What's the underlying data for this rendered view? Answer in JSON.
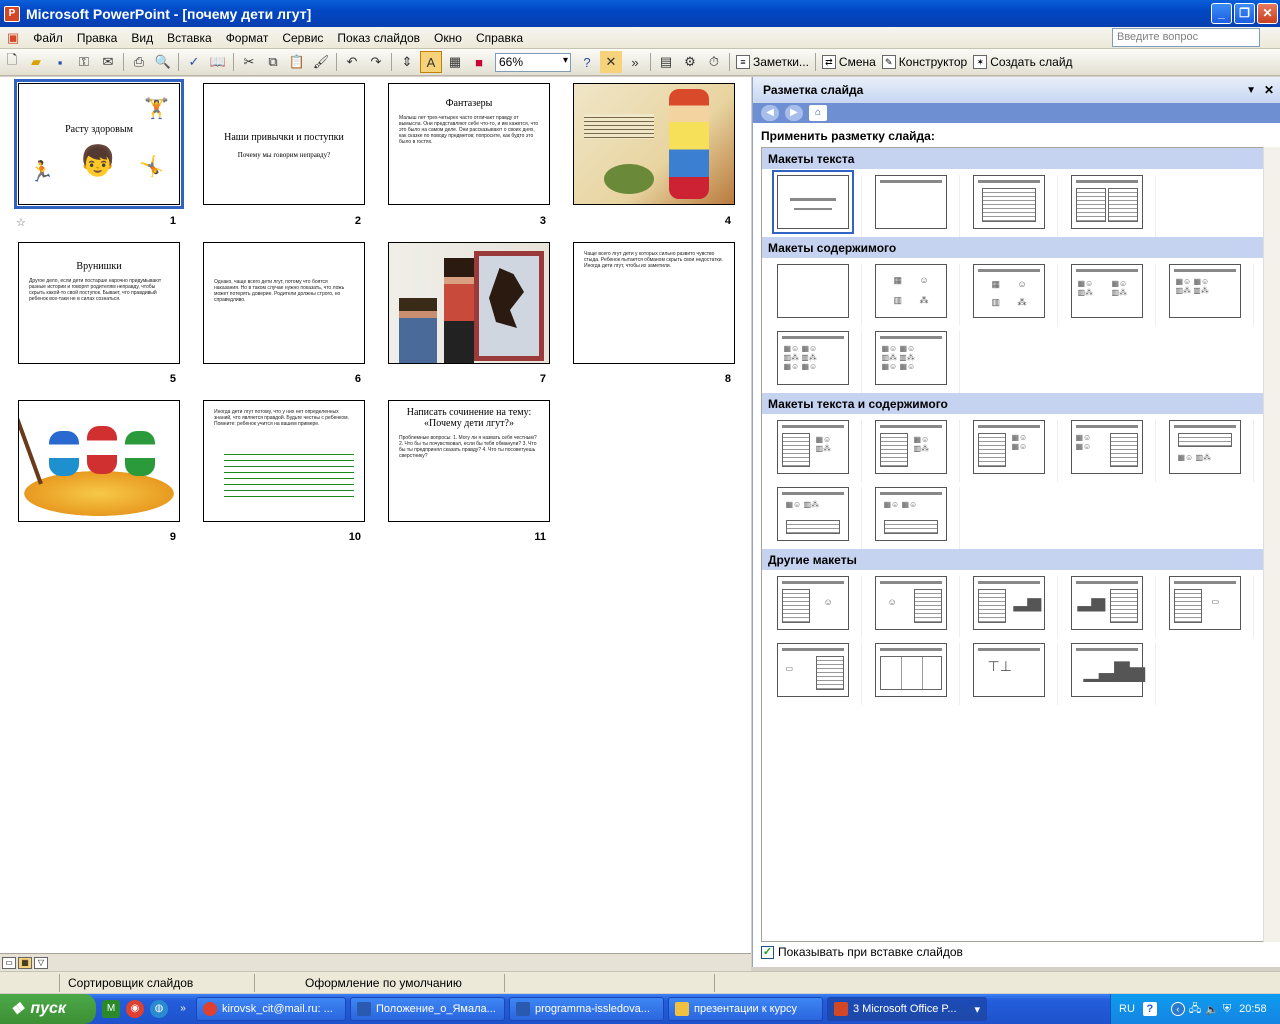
{
  "window": {
    "title": "Microsoft PowerPoint - [почему дети лгут]",
    "app_icon_label": "P"
  },
  "menu": {
    "items": [
      "Файл",
      "Правка",
      "Вид",
      "Вставка",
      "Формат",
      "Сервис",
      "Показ слайдов",
      "Окно",
      "Справка"
    ],
    "help_placeholder": "Введите вопрос"
  },
  "toolbar": {
    "zoom": "66%",
    "notes_label": "Заметки...",
    "transition_label": "Смена",
    "designer_label": "Конструктор",
    "new_slide_label": "Создать слайд"
  },
  "slides": [
    {
      "num": "1",
      "title": "Расту здоровым"
    },
    {
      "num": "2",
      "title": "Наши привычки и поступки",
      "subtitle": "Почему мы говорим неправду?"
    },
    {
      "num": "3",
      "title": "Фантазеры",
      "body": "Малыш лет трех-четырех часто отличает правду от вымысла. Они представляют себе что-то, и им кажется, что это было на самом деле. Они рассказывают о своих днях, как сказке по поводу предметов; попросите, как будто это было в гостях."
    },
    {
      "num": "4",
      "image": "pinocchio"
    },
    {
      "num": "5",
      "title": "Врунишки",
      "body": "Другое дело, если дети постарше нарочно придумывают разные истории и говорят родителям неправду, чтобы скрыть какой-то свой поступок. Бывает, что правдивый ребенок все-таки не в силах сознаться."
    },
    {
      "num": "6",
      "body": "Однако, чаще всего дети лгут, потому что боятся наказания. Но в таком случае нужно показать, что ложь может потерять доверие. Родители должны строго, но справедливо."
    },
    {
      "num": "7",
      "image": "boy-and-mother"
    },
    {
      "num": "8",
      "body": "Чаще всего лгут дети у которых сильно развито чувство стыда. Ребенок пытается обманом скрыть свои недостатки. Иногда дети лгут, чтобы их заметили."
    },
    {
      "num": "9",
      "image": "cartoon-ducks"
    },
    {
      "num": "10",
      "body": "Иногда дети лгут потому, что у них нет определенных знаний, что является правдой. Будьте честны с ребенком. Помните: ребенок учится на вашем примере."
    },
    {
      "num": "11",
      "title": "Написать сочинение на тему: «Почему дети лгут?»",
      "body": "Проблемные вопросы: 1. Могу ли я назвать себя честным? 2. Что бы ты почувствовал, если бы тебя обманули? 3. Что бы ты предпринял сказать правду? 4. Что ты посоветуешь сверстнику?"
    }
  ],
  "pane": {
    "title": "Разметка слайда",
    "apply_label": "Применить разметку слайда:",
    "groups": [
      "Макеты текста",
      "Макеты содержимого",
      "Макеты текста и содержимого",
      "Другие макеты"
    ],
    "show_on_insert": "Показывать при вставке слайдов"
  },
  "status": {
    "view": "Сортировщик слайдов",
    "design": "Оформление по умолчанию"
  },
  "taskbar": {
    "start": "пуск",
    "buttons": [
      "kirovsk_cit@mail.ru: ...",
      "Положение_о_Ямала...",
      "programma-issledova...",
      "презентации к курсу",
      "3 Microsoft Office P..."
    ],
    "lang": "RU",
    "clock": "20:58"
  }
}
